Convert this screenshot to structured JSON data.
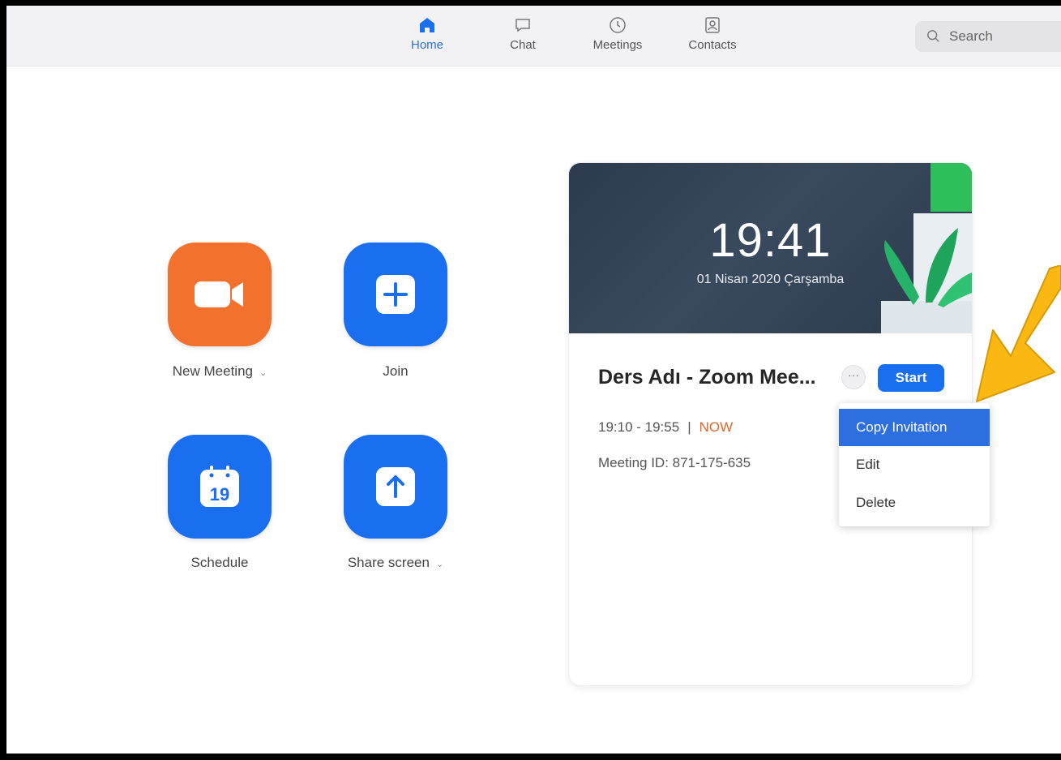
{
  "nav": {
    "tabs": [
      {
        "label": "Home",
        "icon": "home-icon",
        "active": true
      },
      {
        "label": "Chat",
        "icon": "chat-icon",
        "active": false
      },
      {
        "label": "Meetings",
        "icon": "clock-icon",
        "active": false
      },
      {
        "label": "Contacts",
        "icon": "contacts-icon",
        "active": false
      }
    ],
    "search_placeholder": "Search"
  },
  "actions": {
    "new_meeting": "New Meeting",
    "join": "Join",
    "schedule": "Schedule",
    "schedule_day": "19",
    "share_screen": "Share screen"
  },
  "meeting_card": {
    "clock": "19:41",
    "date": "01 Nisan 2020 Çarşamba",
    "title": "Ders Adı - Zoom Mee...",
    "more_label": "···",
    "start_label": "Start",
    "time_range": "19:10 - 19:55",
    "separator": "|",
    "now_label": "NOW",
    "meeting_id": "Meeting ID: 871-175-635"
  },
  "context_menu": {
    "items": [
      "Copy Invitation",
      "Edit",
      "Delete"
    ],
    "highlighted_index": 0
  },
  "colors": {
    "accent_blue": "#1a6ef0",
    "accent_orange": "#f2712d",
    "now_orange": "#e0672a",
    "annotation_arrow": "#fbb812"
  }
}
